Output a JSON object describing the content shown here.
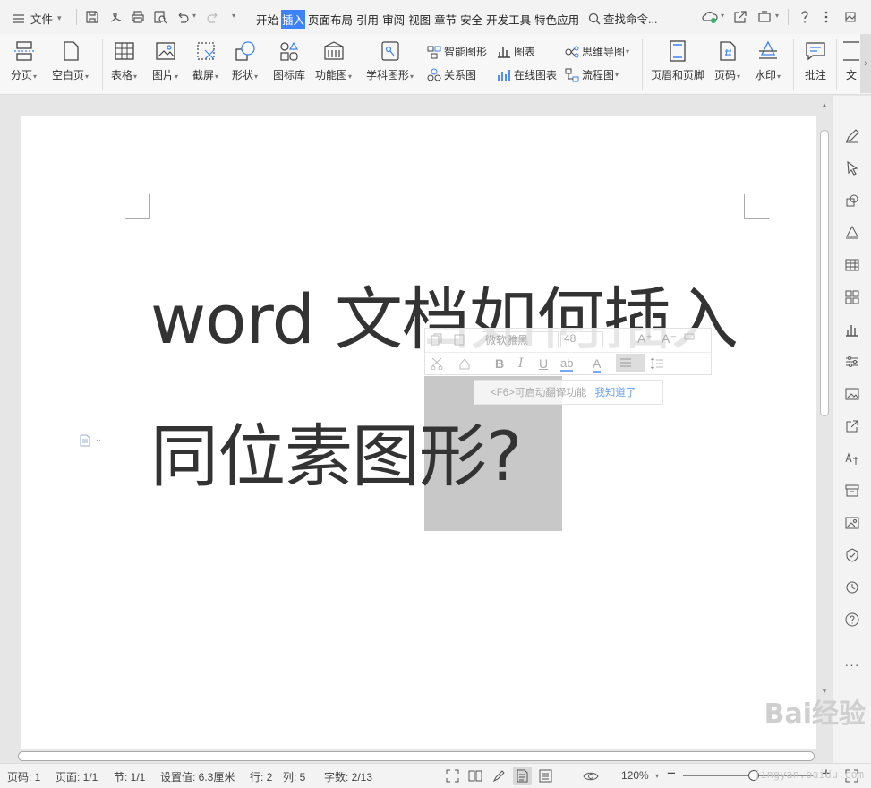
{
  "topbar": {
    "file_label": "文件",
    "tabs": [
      "开始",
      "插入",
      "页面布局",
      "引用",
      "审阅",
      "视图",
      "章节",
      "安全",
      "开发工具",
      "特色应用"
    ],
    "active_tab": "插入",
    "search_label": "查找命令..."
  },
  "ribbon": {
    "page_break": "分页",
    "blank_page": "空白页",
    "table": "表格",
    "picture": "图片",
    "screenshot": "截屏",
    "shapes": "形状",
    "icon_library": "图标库",
    "function_chart": "功能图",
    "subject_graph": "学科图形",
    "smart_art": "智能图形",
    "relation": "关系图",
    "chart": "图表",
    "online_chart": "在线图表",
    "mindmap": "思维导图",
    "flowchart": "流程图",
    "header_footer": "页眉和页脚",
    "page_number": "页码",
    "watermark": "水印",
    "comment": "批注",
    "text_partial": "文"
  },
  "document": {
    "line1": "word 文档如何插入",
    "line2": "同位素图形?"
  },
  "mini_toolbar": {
    "font_name": "微软雅黑",
    "font_size": "48",
    "grow_font": "A⁺",
    "shrink_font": "A⁻",
    "bold": "B",
    "italic": "I",
    "underline": "U",
    "strike": "ab",
    "font_color": "A"
  },
  "hint": {
    "text": "<F6>可启动翻译功能",
    "link": "我知道了"
  },
  "status": {
    "page_num": "页码: 1",
    "pages": "页面: 1/1",
    "section": "节: 1/1",
    "setting": "设置值: 6.3厘米",
    "row": "行: 2",
    "col": "列: 5",
    "words": "字数: 2/13",
    "zoom": "120%"
  },
  "watermark": {
    "brand": "Bai经验",
    "url": "jingyan.baidu.com"
  },
  "colors": {
    "accent": "#3d82f7",
    "selection": "#c8c8c8"
  }
}
